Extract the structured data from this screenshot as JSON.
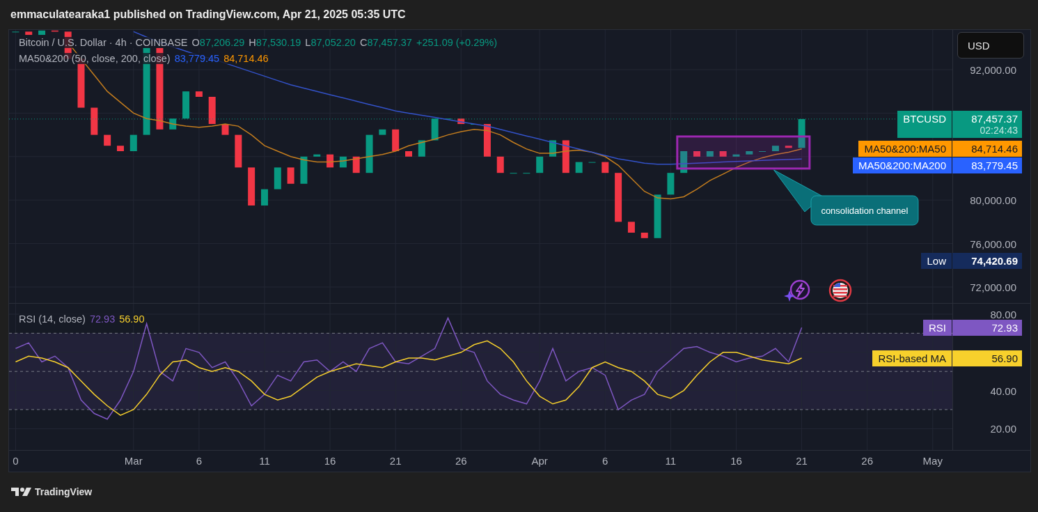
{
  "caption": "emmaculatearaka1 published on TradingView.com, Apr 21, 2025 05:35 UTC",
  "legend": {
    "symbol": "Bitcoin / U.S. Dollar · 4h · COINBASE",
    "ohlc": [
      {
        "label": "O",
        "value": "87,206.29"
      },
      {
        "label": "H",
        "value": "87,530.19"
      },
      {
        "label": "L",
        "value": "87,052.20"
      },
      {
        "label": "C",
        "value": "87,457.37"
      }
    ],
    "change": "+251.09 (+0.29%)",
    "indicator": {
      "title": "MA50&200 (50, close, 200, close)",
      "values": [
        {
          "text": "83,779.45",
          "color": "#2962ff"
        },
        {
          "text": "84,714.46",
          "color": "#ff9800"
        }
      ]
    }
  },
  "price_chart": {
    "callout": "consolidation channel"
  },
  "price_axis": {
    "currency_button": "USD",
    "labels": [
      "92,000.00",
      "80,000.00",
      "76,000.00",
      "72,000.00"
    ],
    "tags": [
      {
        "kind": "last",
        "label": "BTCUSD",
        "value": "87,457.37",
        "countdown": "02:24:43",
        "color": "#089981"
      },
      {
        "kind": "ma",
        "label": "MA50&200:MA50",
        "value": "84,714.46",
        "color": "#ff9800"
      },
      {
        "kind": "ma",
        "label": "MA50&200:MA200",
        "value": "83,779.45",
        "color": "#2962ff"
      },
      {
        "kind": "low",
        "label": "Low",
        "value": "74,420.69",
        "color": "#152b5c"
      }
    ]
  },
  "rsi_legend": {
    "title": "RSI (14, close)",
    "values": [
      {
        "text": "72.93",
        "color": "#7e57c2"
      },
      {
        "text": "56.90",
        "color": "#f7d02c"
      }
    ]
  },
  "rsi_chart": {
    "chart_data": {
      "type": "line",
      "grid": true,
      "categories": [
        "0",
        null,
        null,
        null,
        null,
        null,
        null,
        null,
        null,
        "Mar",
        null,
        null,
        null,
        null,
        "6",
        null,
        null,
        null,
        null,
        "11",
        null,
        null,
        null,
        null,
        "16",
        null,
        null,
        null,
        null,
        "21",
        null,
        null,
        null,
        null,
        "26",
        null,
        null,
        null,
        null,
        null,
        "Apr",
        null,
        null,
        null,
        null,
        "6",
        null,
        null,
        null,
        null,
        "11",
        null,
        null,
        null,
        null,
        "16",
        null,
        null,
        null,
        null,
        "21",
        null,
        null,
        null,
        null,
        "26",
        null,
        null,
        null,
        null,
        "May",
        null
      ],
      "ylim": [
        8.83,
        85.47
      ],
      "yticks": [
        {
          "value": 20,
          "label": "20.00"
        },
        {
          "value": 40,
          "label": "40.00"
        },
        {
          "value": 80,
          "label": "80.00"
        }
      ],
      "series": [
        {
          "color": "#7e57c2",
          "values": [
            62,
            65,
            55,
            58,
            52,
            35,
            28,
            25,
            35,
            50,
            75,
            50,
            45,
            62,
            60,
            52,
            55,
            45,
            32,
            38,
            48,
            45,
            55,
            56,
            50,
            55,
            50,
            62,
            65,
            55,
            54,
            58,
            62,
            78,
            62,
            60,
            45,
            38,
            35,
            33,
            45,
            62,
            45,
            50,
            52,
            48,
            30,
            35,
            38,
            50,
            56,
            62,
            63,
            60,
            58,
            55,
            57,
            58,
            62,
            55,
            73,
            null,
            null,
            null,
            null,
            null,
            null,
            null,
            null,
            null,
            null,
            null
          ]
        },
        {
          "color": "#f7d02c",
          "values": [
            55,
            58,
            57,
            55,
            52,
            45,
            38,
            32,
            27,
            30,
            38,
            48,
            55,
            56,
            52,
            50,
            52,
            50,
            45,
            38,
            35,
            37,
            42,
            47,
            50,
            52,
            54,
            53,
            52,
            55,
            57,
            57,
            56,
            58,
            60,
            64,
            66,
            62,
            55,
            45,
            37,
            33,
            35,
            42,
            52,
            55,
            52,
            50,
            45,
            38,
            36,
            40,
            48,
            55,
            60,
            60,
            58,
            56,
            55,
            54,
            57,
            null,
            null,
            null,
            null,
            null,
            null,
            null,
            null,
            null,
            null,
            null
          ]
        }
      ]
    }
  },
  "rsi_axis": {
    "tags": [
      {
        "label": "RSI",
        "value": "72.93",
        "color": "#7e57c2"
      },
      {
        "label": "RSI-based MA",
        "value": "56.90",
        "color": "#f7d02c"
      }
    ]
  },
  "footer": {
    "brand": "TradingView"
  }
}
